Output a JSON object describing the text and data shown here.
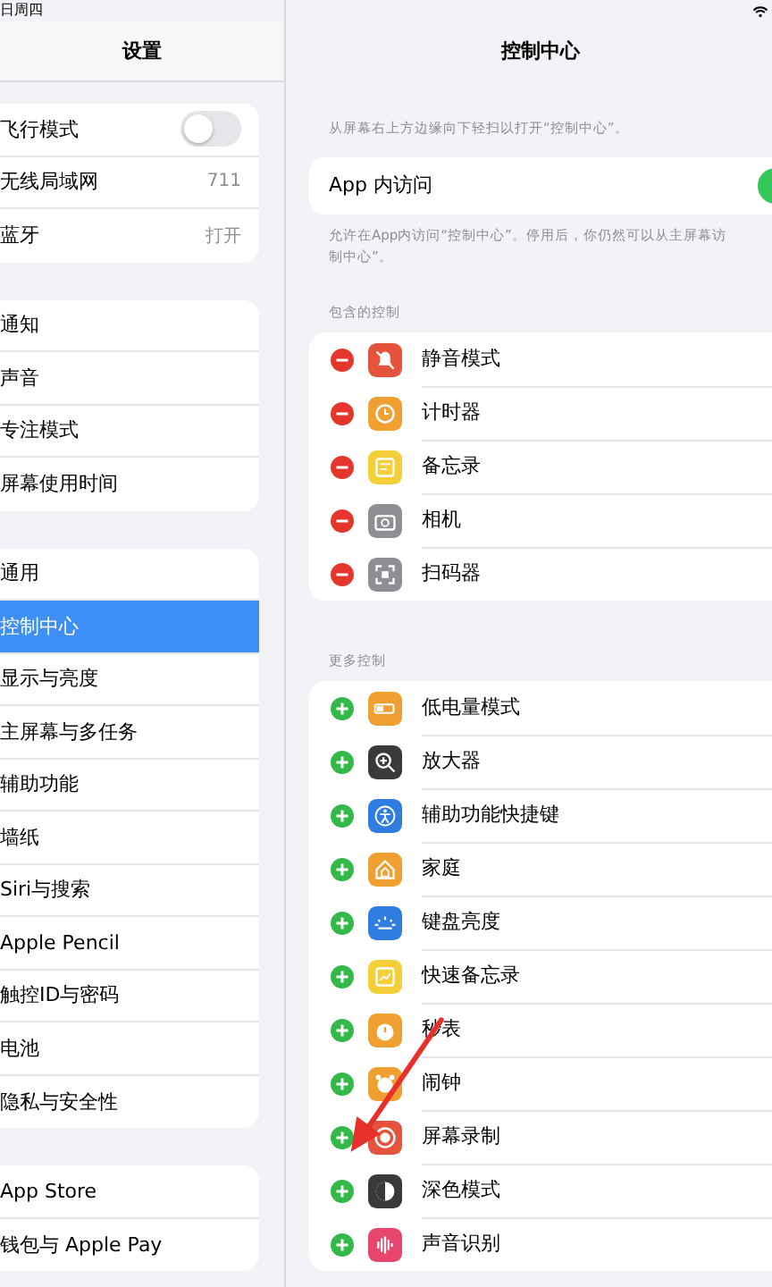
{
  "status_bar": {
    "date": "日周四"
  },
  "sidebar": {
    "title": "设置",
    "groups": [
      [
        {
          "label": "飞行模式",
          "kind": "toggle",
          "on": false,
          "selected": false
        },
        {
          "label": "无线局域网",
          "kind": "value",
          "value": "711",
          "selected": false
        },
        {
          "label": "蓝牙",
          "kind": "value",
          "value": "打开",
          "selected": false
        }
      ],
      [
        {
          "label": "通知",
          "kind": "link",
          "selected": false
        },
        {
          "label": "声音",
          "kind": "link",
          "selected": false
        },
        {
          "label": "专注模式",
          "kind": "link",
          "selected": false
        },
        {
          "label": "屏幕使用时间",
          "kind": "link",
          "selected": false
        }
      ],
      [
        {
          "label": "通用",
          "kind": "link",
          "selected": false
        },
        {
          "label": "控制中心",
          "kind": "link",
          "selected": true
        },
        {
          "label": "显示与亮度",
          "kind": "link",
          "selected": false
        },
        {
          "label": "主屏幕与多任务",
          "kind": "link",
          "selected": false
        },
        {
          "label": "辅助功能",
          "kind": "link",
          "selected": false
        },
        {
          "label": "墙纸",
          "kind": "link",
          "selected": false
        },
        {
          "label": "Siri与搜索",
          "kind": "link",
          "selected": false
        },
        {
          "label": "Apple Pencil",
          "kind": "link",
          "selected": false
        },
        {
          "label": "触控ID与密码",
          "kind": "link",
          "selected": false
        },
        {
          "label": "电池",
          "kind": "link",
          "selected": false
        },
        {
          "label": "隐私与安全性",
          "kind": "link",
          "selected": false
        }
      ],
      [
        {
          "label": "App Store",
          "kind": "link",
          "selected": false
        },
        {
          "label": "钱包与 Apple Pay",
          "kind": "link",
          "selected": false
        }
      ]
    ]
  },
  "detail": {
    "title": "控制中心",
    "hint": "从屏幕右上方边缘向下轻扫以打开“控制中心”。",
    "access": {
      "label": "App 内访问",
      "on": true
    },
    "access_note": [
      "允许在App内访问“控制中心”。停用后，你仍然可以从主屏幕访",
      "制中心”。"
    ],
    "sections": [
      {
        "heading": "包含的控制",
        "kind": "included",
        "items": [
          {
            "label": "静音模式",
            "color": "#e5533d"
          },
          {
            "label": "计时器",
            "color": "#f0a030"
          },
          {
            "label": "备忘录",
            "color": "#f5cf3a"
          },
          {
            "label": "相机",
            "color": "#8e8e93"
          },
          {
            "label": "扫码器",
            "color": "#8e8e93"
          }
        ]
      },
      {
        "heading": "更多控制",
        "kind": "more",
        "items": [
          {
            "label": "低电量模式",
            "color": "#f0a030"
          },
          {
            "label": "放大器",
            "color": "#3a3a3c"
          },
          {
            "label": "辅助功能快捷键",
            "color": "#2f7de1"
          },
          {
            "label": "家庭",
            "color": "#f0a030"
          },
          {
            "label": "键盘亮度",
            "color": "#2f7de1"
          },
          {
            "label": "快速备忘录",
            "color": "#f5cf3a"
          },
          {
            "label": "秒表",
            "color": "#f0a030"
          },
          {
            "label": "闹钟",
            "color": "#f0a030"
          },
          {
            "label": "屏幕录制",
            "color": "#e5533d"
          },
          {
            "label": "深色模式",
            "color": "#3a3a3c"
          },
          {
            "label": "声音识别",
            "color": "#e8456e"
          }
        ]
      }
    ]
  }
}
